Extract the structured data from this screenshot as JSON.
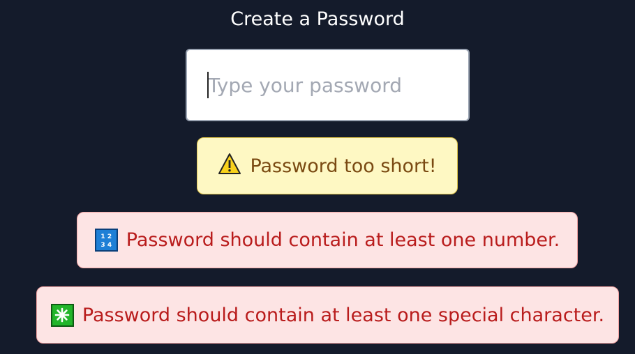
{
  "form": {
    "title": "Create a Password",
    "password_value": "",
    "password_placeholder": "Type your password"
  },
  "messages": [
    {
      "type": "warning",
      "icon": "warning-icon",
      "text": "Password too short!",
      "color": "#fef8c3"
    },
    {
      "type": "error",
      "icon": "input-numbers-icon",
      "text": "Password should contain at least one number.",
      "color": "#fde4e4"
    },
    {
      "type": "error",
      "icon": "eight-spoked-asterisk-icon",
      "text": "Password should contain at least one special character.",
      "color": "#fde4e4"
    }
  ],
  "icons": {
    "numbers_digits": [
      "1",
      "2",
      "3",
      "4"
    ]
  },
  "colors": {
    "background": "#141b2b",
    "warning_text": "#7a4a12",
    "error_text": "#b91c1c"
  }
}
